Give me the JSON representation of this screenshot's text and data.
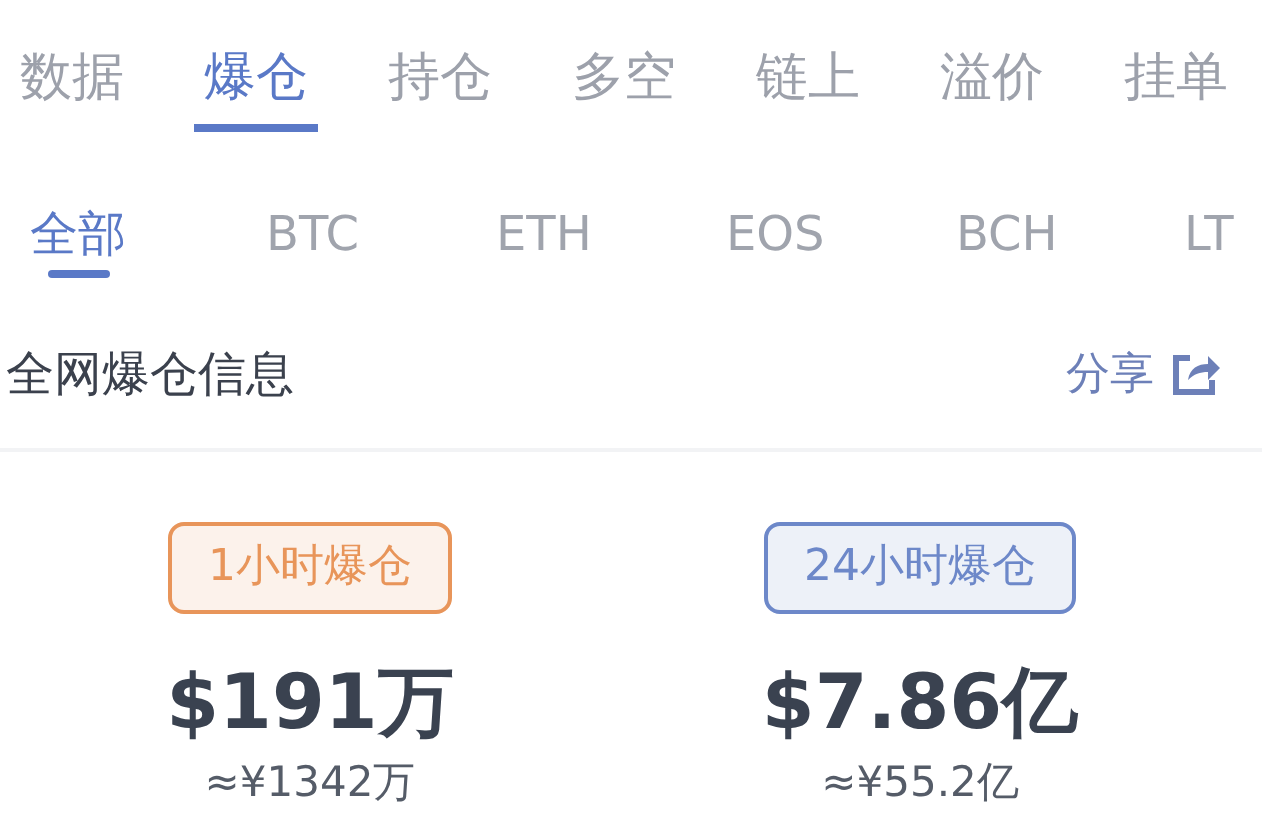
{
  "tabs": [
    {
      "label": "数据",
      "selected": false
    },
    {
      "label": "爆仓",
      "selected": true
    },
    {
      "label": "持仓",
      "selected": false
    },
    {
      "label": "多空",
      "selected": false
    },
    {
      "label": "链上",
      "selected": false
    },
    {
      "label": "溢价",
      "selected": false
    },
    {
      "label": "挂单",
      "selected": false
    }
  ],
  "coin_tabs": [
    {
      "label": "全部",
      "selected": true
    },
    {
      "label": "BTC",
      "selected": false
    },
    {
      "label": "ETH",
      "selected": false
    },
    {
      "label": "EOS",
      "selected": false
    },
    {
      "label": "BCH",
      "selected": false
    },
    {
      "label": "LT",
      "selected": false
    }
  ],
  "section": {
    "title": "全网爆仓信息",
    "share": "分享"
  },
  "stats": [
    {
      "label": "1小时爆仓",
      "color": "#e8955a",
      "value": "$191万",
      "cny": "≈¥1342万"
    },
    {
      "label": "24小时爆仓",
      "color": "#6d88c9",
      "value": "$7.86亿",
      "cny": "≈¥55.2亿"
    }
  ]
}
